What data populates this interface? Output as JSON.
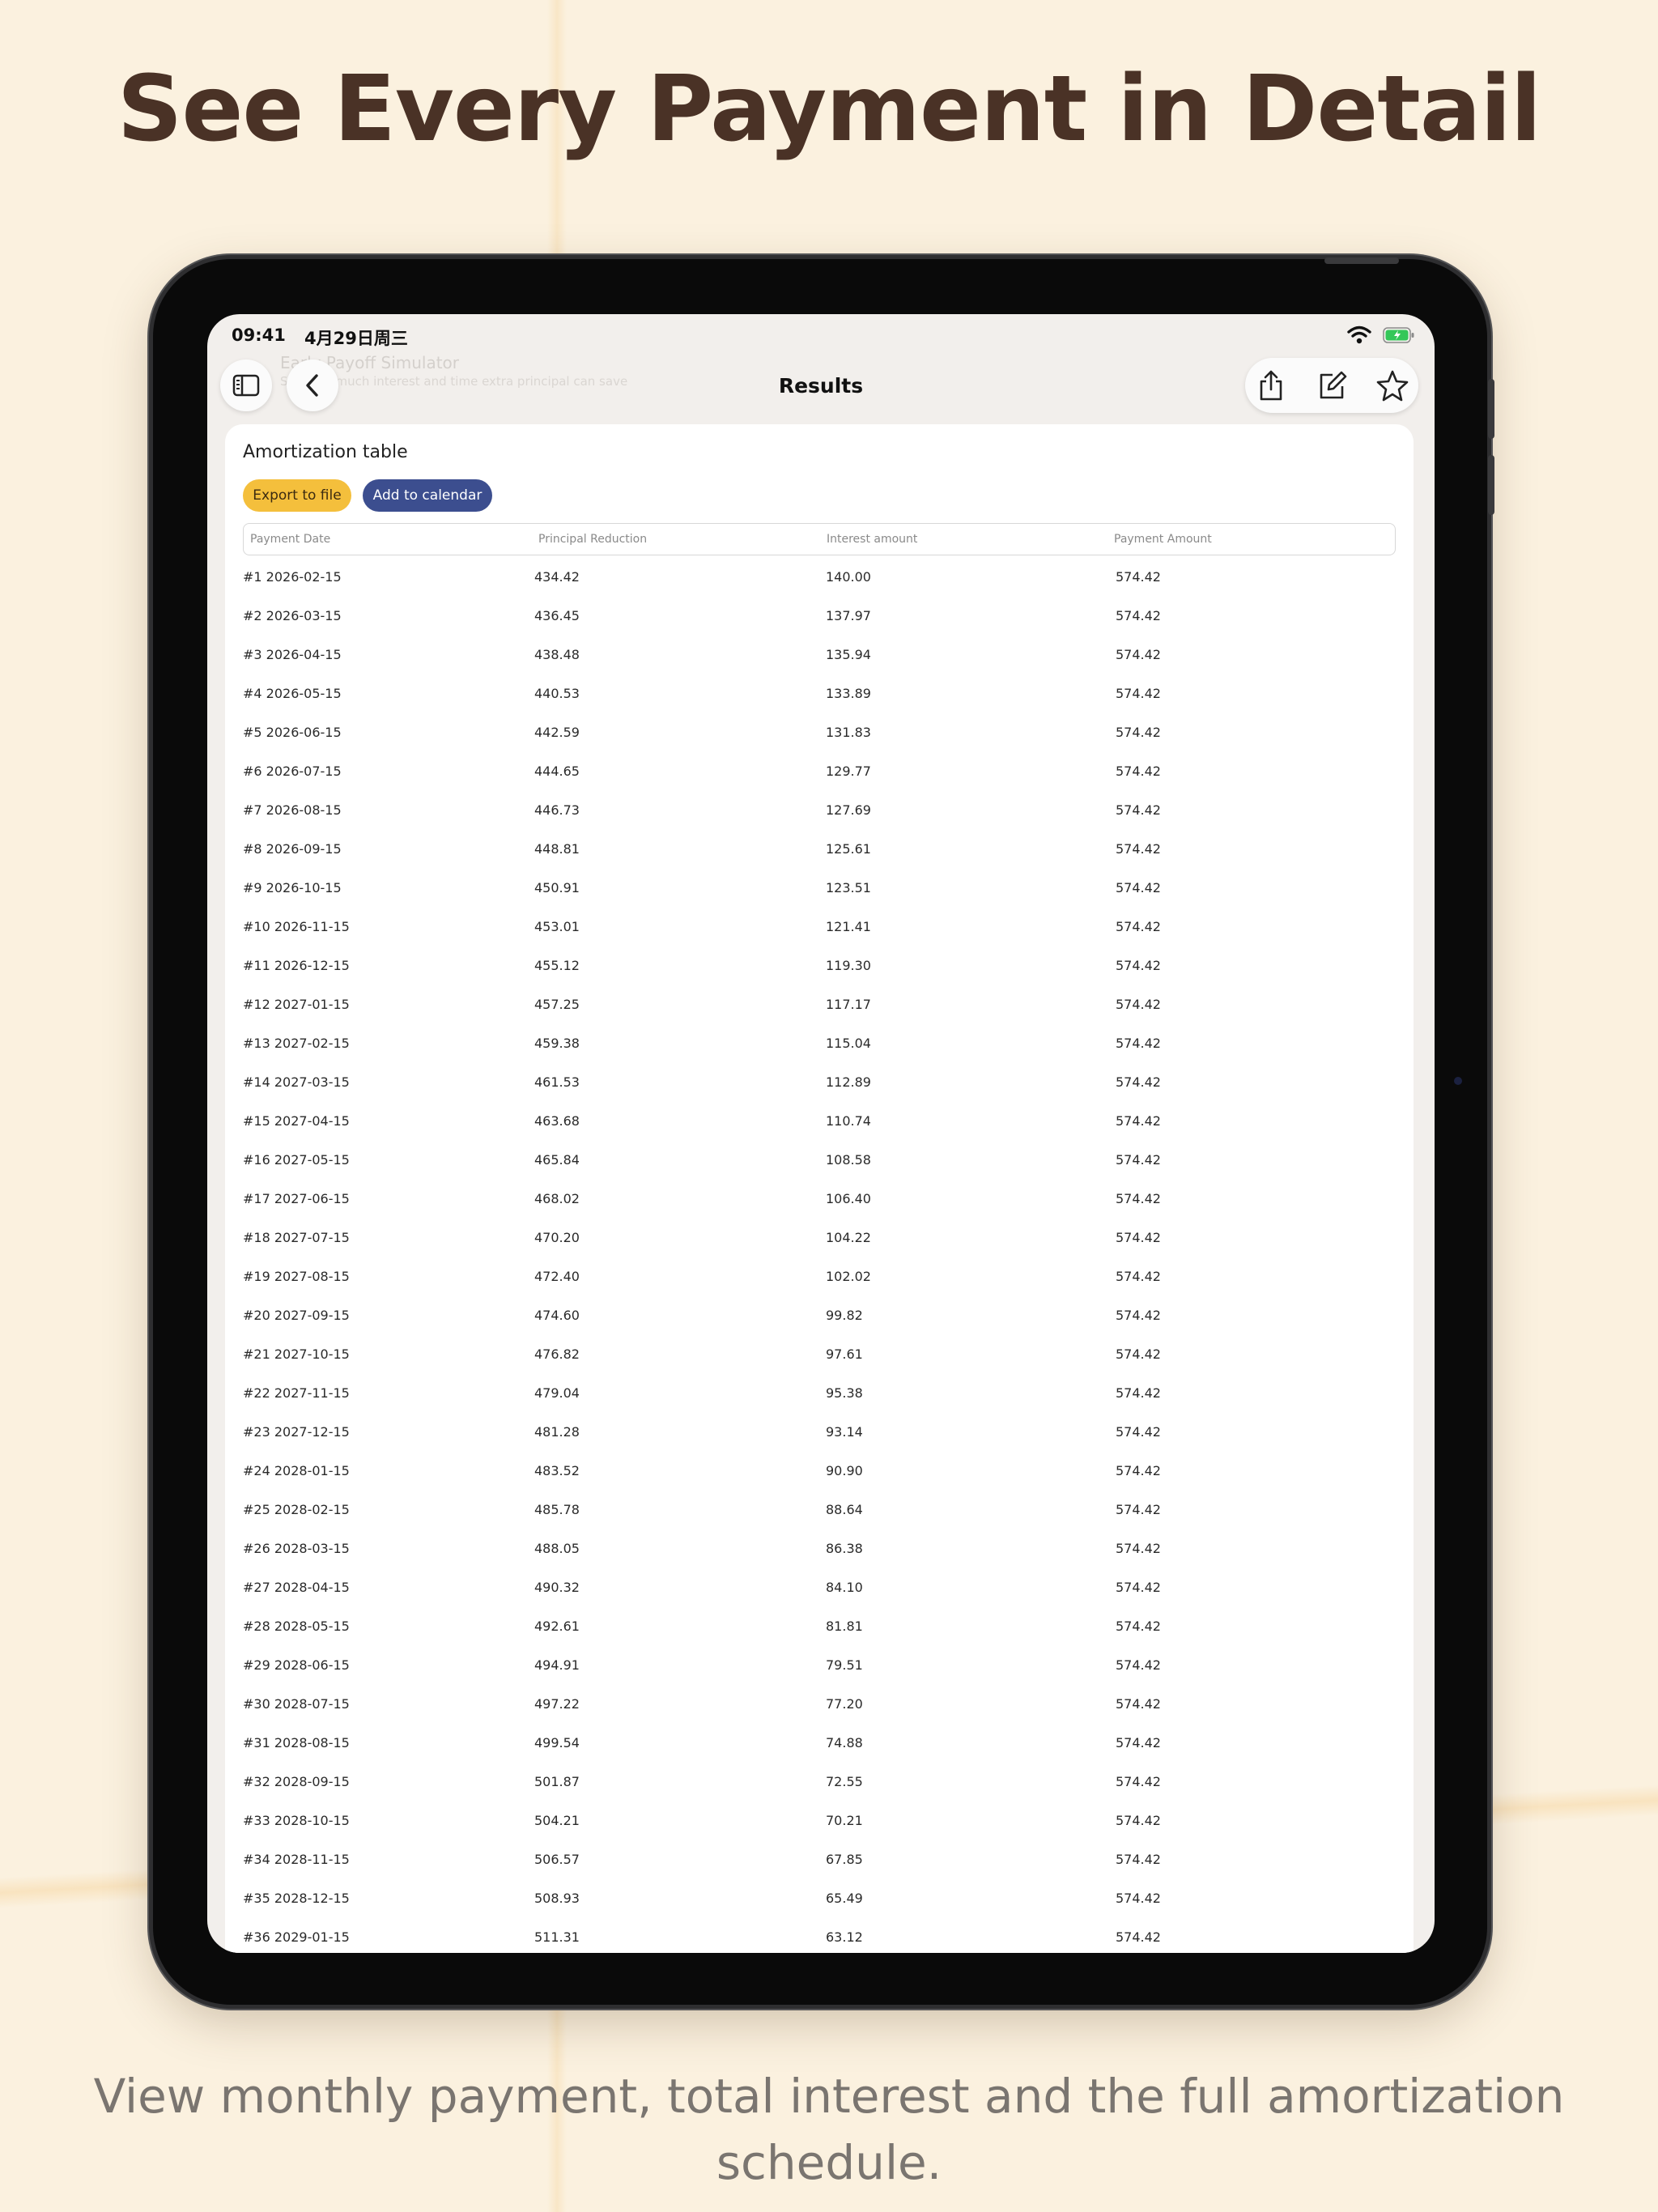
{
  "marketing": {
    "headline": "See Every Payment in Detail",
    "caption": "View monthly payment, total interest and the full amortization schedule."
  },
  "status_bar": {
    "time": "09:41",
    "date": "4月29日周三"
  },
  "nav": {
    "title": "Results",
    "faded_title": "Early Payoff Simulator",
    "faded_subtitle": "See how much interest and time extra principal can save",
    "icons": [
      "sidebar-icon",
      "chevron-left-icon",
      "share-icon",
      "edit-icon",
      "star-icon"
    ]
  },
  "card": {
    "title": "Amortization table",
    "export_label": "Export to file",
    "calendar_label": "Add to calendar"
  },
  "table": {
    "headers": [
      "Payment Date",
      "Principal Reduction",
      "Interest amount",
      "Payment Amount"
    ],
    "rows": [
      [
        "#1 2026-02-15",
        "434.42",
        "140.00",
        "574.42"
      ],
      [
        "#2 2026-03-15",
        "436.45",
        "137.97",
        "574.42"
      ],
      [
        "#3 2026-04-15",
        "438.48",
        "135.94",
        "574.42"
      ],
      [
        "#4 2026-05-15",
        "440.53",
        "133.89",
        "574.42"
      ],
      [
        "#5 2026-06-15",
        "442.59",
        "131.83",
        "574.42"
      ],
      [
        "#6 2026-07-15",
        "444.65",
        "129.77",
        "574.42"
      ],
      [
        "#7 2026-08-15",
        "446.73",
        "127.69",
        "574.42"
      ],
      [
        "#8 2026-09-15",
        "448.81",
        "125.61",
        "574.42"
      ],
      [
        "#9 2026-10-15",
        "450.91",
        "123.51",
        "574.42"
      ],
      [
        "#10 2026-11-15",
        "453.01",
        "121.41",
        "574.42"
      ],
      [
        "#11 2026-12-15",
        "455.12",
        "119.30",
        "574.42"
      ],
      [
        "#12 2027-01-15",
        "457.25",
        "117.17",
        "574.42"
      ],
      [
        "#13 2027-02-15",
        "459.38",
        "115.04",
        "574.42"
      ],
      [
        "#14 2027-03-15",
        "461.53",
        "112.89",
        "574.42"
      ],
      [
        "#15 2027-04-15",
        "463.68",
        "110.74",
        "574.42"
      ],
      [
        "#16 2027-05-15",
        "465.84",
        "108.58",
        "574.42"
      ],
      [
        "#17 2027-06-15",
        "468.02",
        "106.40",
        "574.42"
      ],
      [
        "#18 2027-07-15",
        "470.20",
        "104.22",
        "574.42"
      ],
      [
        "#19 2027-08-15",
        "472.40",
        "102.02",
        "574.42"
      ],
      [
        "#20 2027-09-15",
        "474.60",
        "99.82",
        "574.42"
      ],
      [
        "#21 2027-10-15",
        "476.82",
        "97.61",
        "574.42"
      ],
      [
        "#22 2027-11-15",
        "479.04",
        "95.38",
        "574.42"
      ],
      [
        "#23 2027-12-15",
        "481.28",
        "93.14",
        "574.42"
      ],
      [
        "#24 2028-01-15",
        "483.52",
        "90.90",
        "574.42"
      ],
      [
        "#25 2028-02-15",
        "485.78",
        "88.64",
        "574.42"
      ],
      [
        "#26 2028-03-15",
        "488.05",
        "86.38",
        "574.42"
      ],
      [
        "#27 2028-04-15",
        "490.32",
        "84.10",
        "574.42"
      ],
      [
        "#28 2028-05-15",
        "492.61",
        "81.81",
        "574.42"
      ],
      [
        "#29 2028-06-15",
        "494.91",
        "79.51",
        "574.42"
      ],
      [
        "#30 2028-07-15",
        "497.22",
        "77.20",
        "574.42"
      ],
      [
        "#31 2028-08-15",
        "499.54",
        "74.88",
        "574.42"
      ],
      [
        "#32 2028-09-15",
        "501.87",
        "72.55",
        "574.42"
      ],
      [
        "#33 2028-10-15",
        "504.21",
        "70.21",
        "574.42"
      ],
      [
        "#34 2028-11-15",
        "506.57",
        "67.85",
        "574.42"
      ],
      [
        "#35 2028-12-15",
        "508.93",
        "65.49",
        "574.42"
      ],
      [
        "#36 2029-01-15",
        "511.31",
        "63.12",
        "574.42"
      ]
    ]
  },
  "colors": {
    "background": "#fbf1df",
    "headline": "#4a3226",
    "export_button": "#f4bf3c",
    "calendar_button": "#3c4e8f",
    "battery": "#34c759"
  }
}
